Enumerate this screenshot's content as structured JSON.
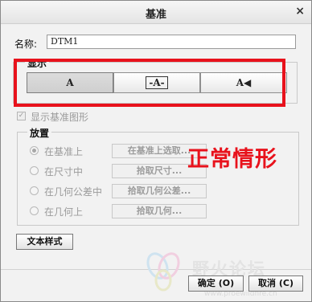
{
  "dialog": {
    "title": "基准",
    "close_glyph": "×"
  },
  "name": {
    "label": "名称:",
    "value": "DTM1"
  },
  "display": {
    "group_label": "显示",
    "segments": [
      {
        "label": "A",
        "icon": "text-plain-icon"
      },
      {
        "label": "-A-",
        "icon": "text-bracketed-icon"
      },
      {
        "label": "A◀",
        "icon": "text-arrow-icon"
      }
    ],
    "checkbox_label": "显示基准图形",
    "checkbox_checked": true
  },
  "placement": {
    "group_label": "放置",
    "options": [
      {
        "label": "在基准上",
        "button": "在基准上选取...",
        "selected": true
      },
      {
        "label": "在尺寸中",
        "button": "拾取尺寸...",
        "selected": false
      },
      {
        "label": "在几何公差中",
        "button": "拾取几何公差...",
        "selected": false
      },
      {
        "label": "在几何上",
        "button": "拾取几何...",
        "selected": false
      }
    ]
  },
  "text_style_button": "文本样式",
  "annotation": {
    "text": "正常情形",
    "color": "#e8121c"
  },
  "footer": {
    "ok": "确定 (O)",
    "cancel": "取消 (C)"
  },
  "watermark": {
    "text": "野火论坛",
    "url": "www.proewildfire.cn"
  }
}
